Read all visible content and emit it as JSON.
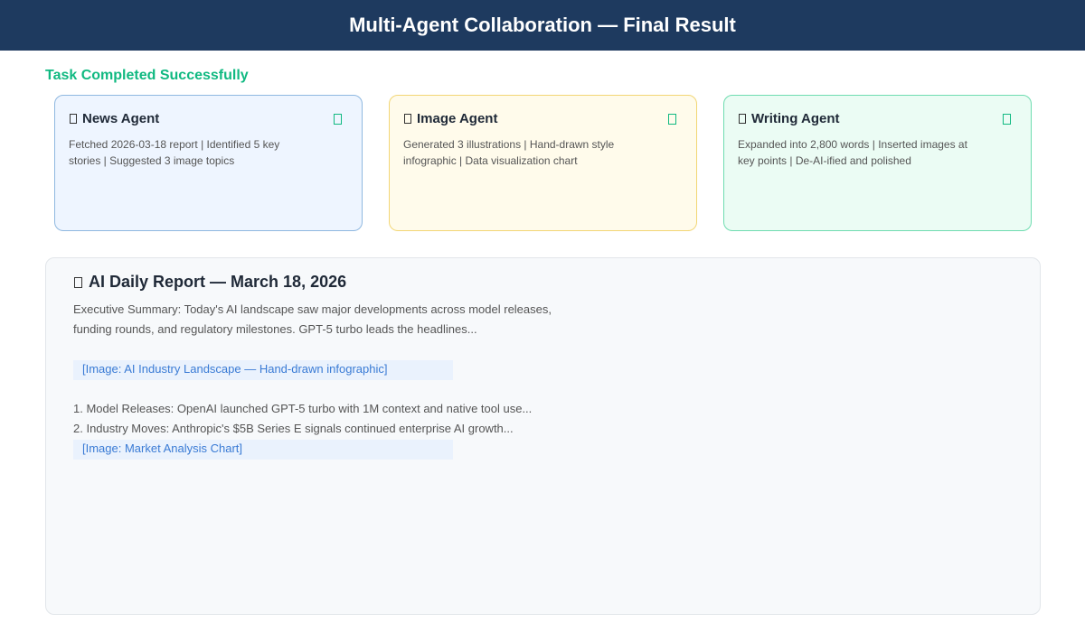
{
  "header": {
    "title": "Multi-Agent Collaboration — Final Result"
  },
  "status": {
    "text": "Task Completed Successfully",
    "color": "#10b981"
  },
  "agents": [
    {
      "title": "News Agent",
      "description": "Fetched 2026-03-18 report | Identified 5 key stories | Suggested 3 image topics",
      "icon": "agent-icon",
      "status_icon": "check-icon"
    },
    {
      "title": "Image Agent",
      "description": "Generated 3 illustrations | Hand-drawn style infographic | Data visualization chart",
      "icon": "agent-icon",
      "status_icon": "check-icon"
    },
    {
      "title": "Writing Agent",
      "description": "Expanded into 2,800 words | Inserted images at key points | De-AI-ified and polished",
      "icon": "agent-icon",
      "status_icon": "check-icon"
    }
  ],
  "report": {
    "title": "AI Daily Report — March 18, 2026",
    "icon": "document-icon",
    "summary": "Executive Summary: Today's AI landscape saw major developments across model releases, funding rounds, and regulatory milestones. GPT-5 turbo leads the headlines...",
    "image_placeholders": [
      "[Image: AI Industry Landscape — Hand-drawn infographic]",
      "[Image: Market Analysis Chart]"
    ],
    "items": [
      "1. Model Releases: OpenAI launched GPT-5 turbo with 1M context and native tool use...",
      "2. Industry Moves: Anthropic's $5B Series E signals continued enterprise AI growth..."
    ]
  },
  "colors": {
    "header_bg": "#1e3a5f",
    "success": "#10b981",
    "link": "#3a7bd5"
  }
}
